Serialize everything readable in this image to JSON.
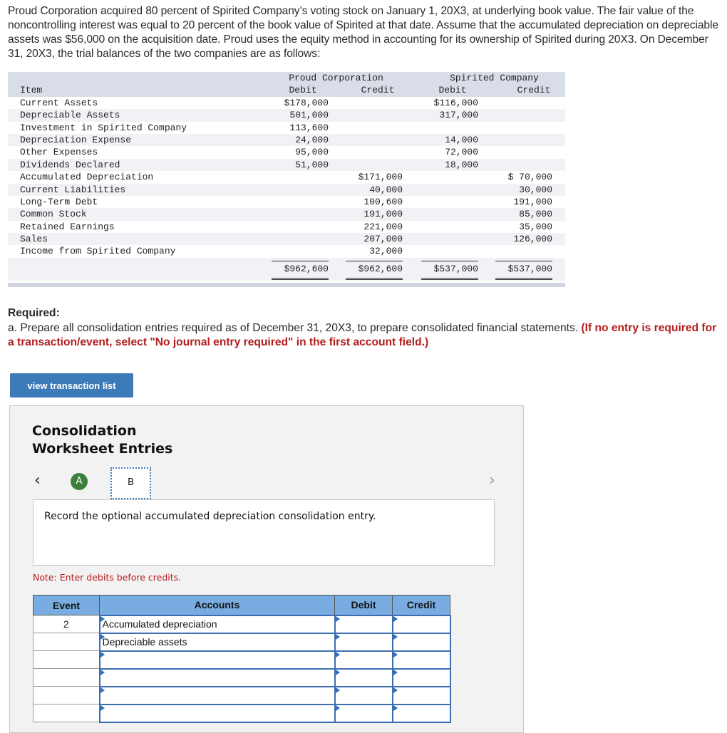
{
  "intro": "Proud Corporation acquired 80 percent of Spirited Company’s voting stock on January 1, 20X3, at underlying book value. The fair value of the noncontrolling interest was equal to 20 percent of the book value of Spirited at that date. Assume that the accumulated depreciation on depreciable assets was $56,000 on the acquisition date. Proud uses the equity method in accounting for its ownership of Spirited during 20X3. On December 31, 20X3, the trial balances of the two companies are as follows:",
  "trial_balance": {
    "groups": [
      "Proud Corporation",
      "Spirited Company"
    ],
    "headers": {
      "item": "Item",
      "debit": "Debit",
      "credit": "Credit"
    },
    "rows": [
      {
        "item": "Current Assets",
        "p_debit": "$178,000",
        "p_credit": "",
        "s_debit": "$116,000",
        "s_credit": ""
      },
      {
        "item": "Depreciable Assets",
        "p_debit": "501,000",
        "p_credit": "",
        "s_debit": "317,000",
        "s_credit": ""
      },
      {
        "item": "Investment in Spirited Company",
        "p_debit": "113,600",
        "p_credit": "",
        "s_debit": "",
        "s_credit": ""
      },
      {
        "item": "Depreciation Expense",
        "p_debit": "24,000",
        "p_credit": "",
        "s_debit": "14,000",
        "s_credit": ""
      },
      {
        "item": "Other Expenses",
        "p_debit": "95,000",
        "p_credit": "",
        "s_debit": "72,000",
        "s_credit": ""
      },
      {
        "item": "Dividends Declared",
        "p_debit": "51,000",
        "p_credit": "",
        "s_debit": "18,000",
        "s_credit": ""
      },
      {
        "item": "Accumulated Depreciation",
        "p_debit": "",
        "p_credit": "$171,000",
        "s_debit": "",
        "s_credit": "$ 70,000"
      },
      {
        "item": "Current Liabilities",
        "p_debit": "",
        "p_credit": "40,000",
        "s_debit": "",
        "s_credit": "30,000"
      },
      {
        "item": "Long-Term Debt",
        "p_debit": "",
        "p_credit": "100,600",
        "s_debit": "",
        "s_credit": "191,000"
      },
      {
        "item": "Common Stock",
        "p_debit": "",
        "p_credit": "191,000",
        "s_debit": "",
        "s_credit": "85,000"
      },
      {
        "item": "Retained Earnings",
        "p_debit": "",
        "p_credit": "221,000",
        "s_debit": "",
        "s_credit": "35,000"
      },
      {
        "item": "Sales",
        "p_debit": "",
        "p_credit": "207,000",
        "s_debit": "",
        "s_credit": "126,000"
      },
      {
        "item": "Income from Spirited Company",
        "p_debit": "",
        "p_credit": "32,000",
        "s_debit": "",
        "s_credit": ""
      }
    ],
    "totals": {
      "p_debit": "$962,600",
      "p_credit": "$962,600",
      "s_debit": "$537,000",
      "s_credit": "$537,000"
    }
  },
  "required": {
    "title": "Required:",
    "text": "a. Prepare all consolidation entries required as of December 31, 20X3, to prepare consolidated financial statements. ",
    "emphasis": "(If no entry is required for a transaction/event, select \"No journal entry required\" in the first account field.)"
  },
  "view_transaction_list_label": "view transaction list",
  "worksheet": {
    "title_line1": "Consolidation",
    "title_line2": "Worksheet Entries",
    "prev_icon": "‹",
    "next_icon": "›",
    "steps": [
      {
        "label": "A",
        "status": "complete"
      },
      {
        "label": "B",
        "status": "current"
      }
    ],
    "prompt": "Record the optional accumulated depreciation consolidation entry.",
    "note": "Note: Enter debits before credits.",
    "table": {
      "headers": [
        "Event",
        "Accounts",
        "Debit",
        "Credit"
      ],
      "rows": [
        {
          "event": "2",
          "account": "Accumulated depreciation",
          "debit": "",
          "credit": ""
        },
        {
          "event": "",
          "account": "Depreciable assets",
          "debit": "",
          "credit": ""
        },
        {
          "event": "",
          "account": "",
          "debit": "",
          "credit": ""
        },
        {
          "event": "",
          "account": "",
          "debit": "",
          "credit": ""
        },
        {
          "event": "",
          "account": "",
          "debit": "",
          "credit": ""
        },
        {
          "event": "",
          "account": "",
          "debit": "",
          "credit": ""
        }
      ]
    }
  }
}
